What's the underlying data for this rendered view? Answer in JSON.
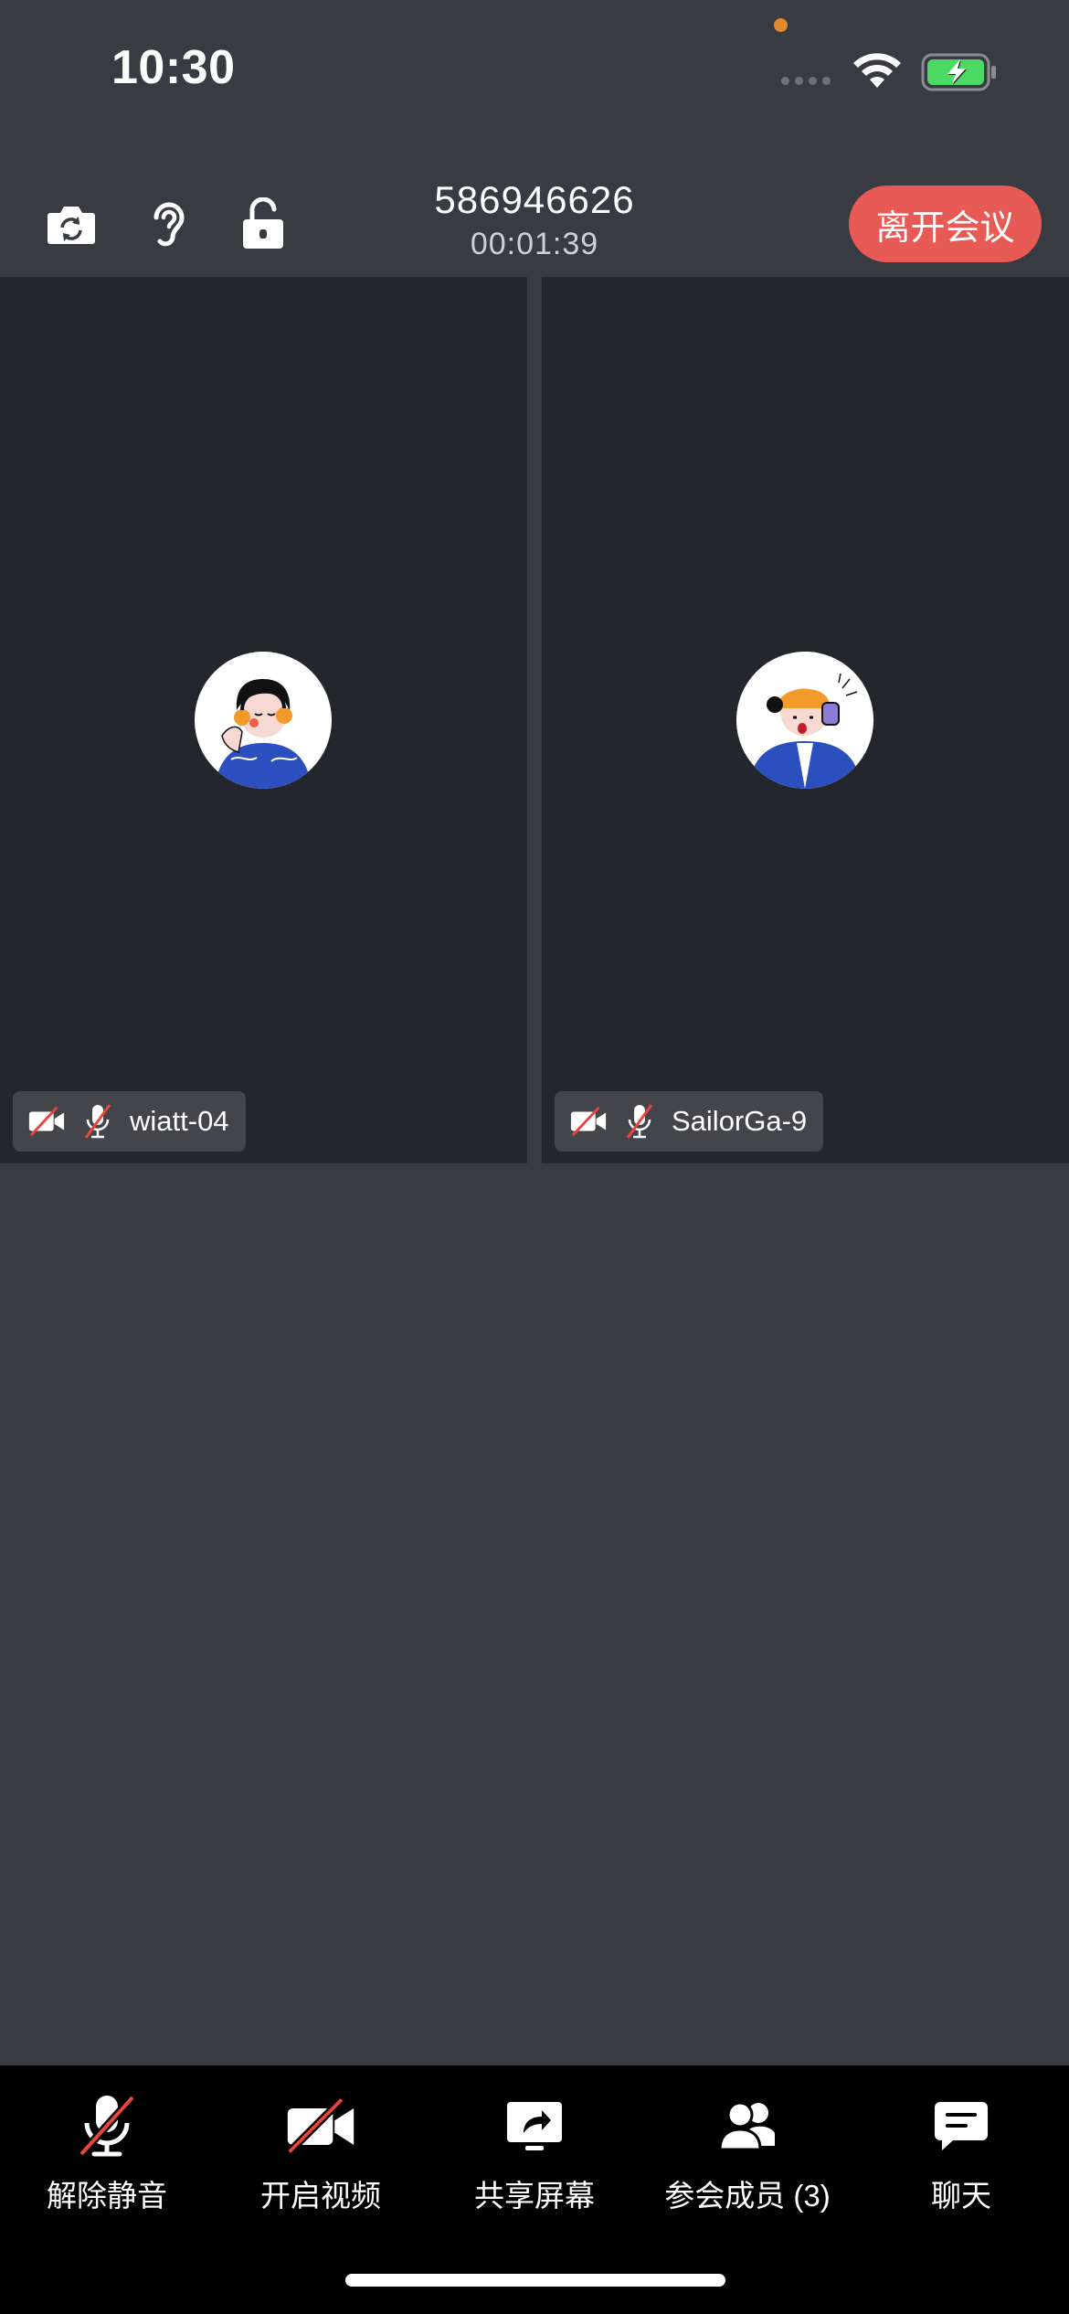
{
  "status_bar": {
    "time": "10:30"
  },
  "header": {
    "meeting_id": "586946626",
    "timer": "00:01:39",
    "leave_label": "离开会议",
    "icons": [
      "camera-switch-icon",
      "ear-icon",
      "unlock-icon"
    ]
  },
  "participants": [
    {
      "name": "wiatt-04",
      "video_on": false,
      "mic_on": false
    },
    {
      "name": "SailorGa-9",
      "video_on": false,
      "mic_on": false
    }
  ],
  "toolbar": {
    "unmute_label": "解除静音",
    "video_label": "开启视频",
    "share_label": "共享屏幕",
    "members_label": "参会成员 (3)",
    "chat_label": "聊天"
  },
  "colors": {
    "background": "#393b42",
    "tile": "#24262d",
    "leave_button": "#e85a55",
    "mute_slash": "#e8453c",
    "battery_fill": "#4cd964"
  }
}
